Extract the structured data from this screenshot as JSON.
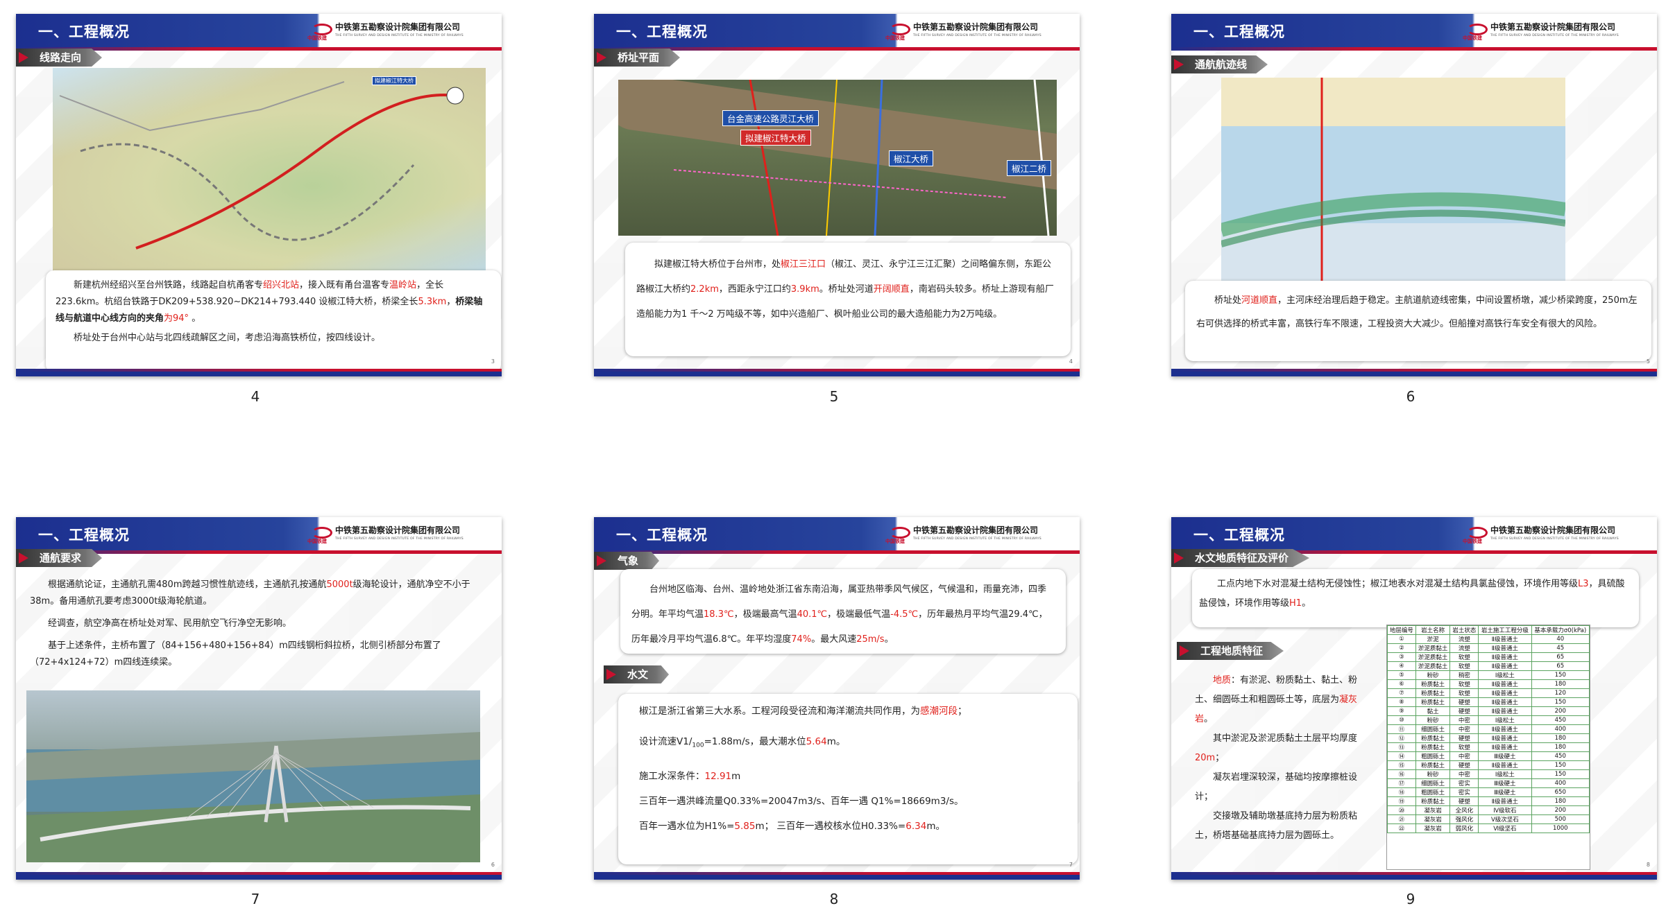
{
  "header": {
    "title": "一、工程概况",
    "company_cn": "中铁第五勘察设计院集团有限公司",
    "company_en": "THE FIFTH SURVEY AND DESIGN INSTITUTE OF THE MINISTRY OF RAILWAYS",
    "logo_sub": "中国铁建"
  },
  "slides": [
    {
      "caption": "4",
      "page_no": "3",
      "tag": "线路走向",
      "map_labels": [
        "拟建椒江特大桥"
      ],
      "paragraphs": [
        [
          "新建杭州经绍兴至台州铁路，线路起自杭甬客专",
          "绍兴北站",
          "，接入既有甬台温客专",
          "温岭站",
          "，全长223.6km。杭绍台铁路于DK209+538.920~DK214+793.440 设椒江特大桥，桥梁全长",
          "5.3km",
          "，",
          "桥梁轴线与航道中心线方向的夹角",
          "为94°",
          " 。"
        ],
        [
          "桥址处于台州中心站与北四线疏解区之间，考虑沿海高铁桥位，按四线设计。"
        ]
      ]
    },
    {
      "caption": "5",
      "page_no": "4",
      "tag": "桥址平面",
      "map_labels": [
        "台金高速公路灵江大桥",
        "拟建椒江特大桥",
        "椒江大桥",
        "椒江二桥"
      ],
      "paragraphs": [
        [
          "拟建椒江特大桥位于台州市，处",
          "椒江三江口",
          "（椒江、灵江、永宁江三江汇聚）之间略偏东侧，东距公路椒江大桥约",
          "2.2km",
          "，西距永宁江口约",
          "3.9km",
          "。桥址处河道",
          "开阔顺直",
          "，南岩码头较多。桥址上游现有船厂造船能力为1 千～2 万吨级不等，如中兴造船厂、枫叶船业公司的最大造船能力为2万吨级。"
        ]
      ]
    },
    {
      "caption": "6",
      "page_no": "5",
      "tag": "通航航迹线",
      "paragraphs": [
        [
          "桥址处",
          "河道顺直",
          "，主河床经治理后趋于稳定。主航道航迹线密集，中间设置桥墩，减少桥梁跨度，250m左右可供选择的桥式丰富，高铁行车不限速，工程投资大大减少。但船撞对高铁行车安全有很大的风险。"
        ]
      ]
    },
    {
      "caption": "7",
      "page_no": "6",
      "tag": "通航要求",
      "paragraphs": [
        [
          "根据通航论证，主通航孔需480m跨越习惯性航迹线，主通航孔按通航",
          "5000t",
          "级海轮设计，通航净空不小于38m。备用通航孔要考虑3000t级海轮航道。"
        ],
        [
          "经调查，航空净高在桥址处对军、民用航空飞行净空无影响。"
        ],
        [
          "基于上述条件，主桥布置了（84+156+480+156+84）m四线钢桁斜拉桥，北侧引桥部分布置了（72+4x124+72）m四线连续梁。"
        ]
      ]
    },
    {
      "caption": "8",
      "page_no": "7",
      "tag_a": "气象",
      "tag_b": "水文",
      "para_a": [
        "台州地区临海、台州、温岭地处浙江省东南沿海，属亚热带季风气候区，气候温和，雨量充沛，四季分明。年平均气温",
        "18.3℃",
        "，极端最高气温",
        "40.1℃",
        "，极端最低气温",
        "-4.5℃",
        "，历年最热月平均气温29.4℃，历年最冷月平均气温6.8℃。年平均湿度",
        "74%",
        "。最大风速",
        "25m/s",
        "。"
      ],
      "hydro": [
        [
          "椒江是浙江省第三大水系。工程河段受径流和海洋潮流共同作用，为",
          "感潮河段",
          "；"
        ],
        [
          "设计流速V1/",
          "100",
          "=1.88m/s，最大潮水位",
          "5.64",
          "m。"
        ],
        [
          "施工水深条件：",
          "12.91",
          "m"
        ],
        [
          "三百年一遇洪峰流量Q0.33%=20047m3/s、百年一遇 Q1%=18669m3/s。"
        ],
        [
          "百年一遇水位为H1%=",
          "5.85",
          "m； 三百年一遇校核水位H0.33%=",
          "6.34",
          "m。"
        ]
      ]
    },
    {
      "caption": "9",
      "page_no": "8",
      "tag_a": "水文地质特征及评价",
      "tag_b": "工程地质特征",
      "para_a": [
        "工点内地下水对混凝土结构无侵蚀性；椒江地表水对混凝土结构具氯盐侵蚀，环境作用等级",
        "L3",
        "，具硫酸盐侵蚀，环境作用等级",
        "H1",
        "。"
      ],
      "geo": [
        [
          "地质",
          "：有淤泥、粉质黏土、黏土、粉土、细圆砾土和粗圆砾土等，底层为",
          "凝灰岩",
          "。"
        ],
        [
          "其中淤泥及淤泥质黏土土层平均厚度",
          "20m",
          "；"
        ],
        [
          "凝灰岩埋深较深，基础均按摩擦桩设计；"
        ],
        [
          "交接墩及辅助墩基底持力层为粉质粘土，桥塔基础基底持力层为圆砾土。"
        ]
      ],
      "table_header": [
        "地层编号",
        "岩土名称",
        "岩土状态",
        "岩土施工工程分级",
        "基本承载力σ0(kPa)"
      ],
      "table_rows": [
        [
          "①",
          "淤泥",
          "流塑",
          "Ⅱ级普通土",
          "40"
        ],
        [
          "②",
          "淤泥质黏土",
          "流塑",
          "Ⅱ级普通土",
          "45"
        ],
        [
          "③",
          "淤泥质黏土",
          "软塑",
          "Ⅱ级普通土",
          "65"
        ],
        [
          "④",
          "淤泥质黏土",
          "软塑",
          "Ⅱ级普通土",
          "65"
        ],
        [
          "⑤",
          "粉砂",
          "稍密",
          "Ⅰ级松土",
          "150"
        ],
        [
          "⑥",
          "粉质黏土",
          "软塑",
          "Ⅱ级普通土",
          "180"
        ],
        [
          "⑦",
          "粉质黏土",
          "软塑",
          "Ⅱ级普通土",
          "120"
        ],
        [
          "⑧",
          "粉质黏土",
          "硬塑",
          "Ⅱ级普通土",
          "150"
        ],
        [
          "⑨",
          "黏土",
          "硬塑",
          "Ⅱ级普通土",
          "200"
        ],
        [
          "⑩",
          "粉砂",
          "中密",
          "Ⅰ级松土",
          "450"
        ],
        [
          "⑪",
          "细圆砾土",
          "中密",
          "Ⅱ级普通土",
          "400"
        ],
        [
          "⑫",
          "粉质黏土",
          "硬塑",
          "Ⅱ级普通土",
          "180"
        ],
        [
          "⑬",
          "粉质黏土",
          "软塑",
          "Ⅱ级普通土",
          "180"
        ],
        [
          "⑭",
          "粗圆砾土",
          "中密",
          "Ⅲ级硬土",
          "450"
        ],
        [
          "⑮",
          "粉质黏土",
          "硬塑",
          "Ⅱ级普通土",
          "150"
        ],
        [
          "⑯",
          "粉砂",
          "中密",
          "Ⅰ级松土",
          "150"
        ],
        [
          "⑰",
          "细圆砾土",
          "密实",
          "Ⅲ级硬土",
          "400"
        ],
        [
          "⑱",
          "粗圆砾土",
          "密实",
          "Ⅲ级硬土",
          "650"
        ],
        [
          "⑲",
          "粉质黏土",
          "硬塑",
          "Ⅱ级普通土",
          "180"
        ],
        [
          "⑳",
          "凝灰岩",
          "全风化",
          "Ⅳ级软石",
          "200"
        ],
        [
          "㉑",
          "凝灰岩",
          "强风化",
          "Ⅴ级次坚石",
          "500"
        ],
        [
          "㉒",
          "凝灰岩",
          "弱风化",
          "Ⅵ级坚石",
          "1000"
        ]
      ]
    }
  ]
}
